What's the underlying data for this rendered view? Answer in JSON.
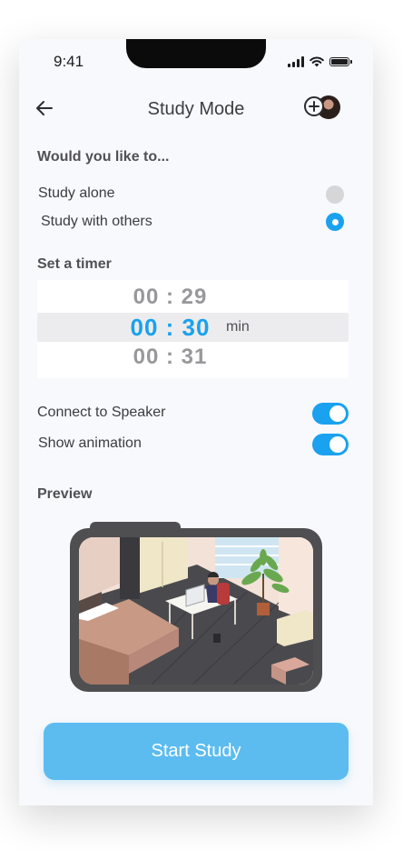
{
  "status_bar": {
    "time": "9:41"
  },
  "header": {
    "title": "Study Mode"
  },
  "study_choice": {
    "heading": "Would you like to...",
    "options": [
      {
        "label": "Study alone",
        "selected": false
      },
      {
        "label": "Study with others",
        "selected": true
      }
    ]
  },
  "timer": {
    "heading": "Set a timer",
    "values": [
      "00 : 29",
      "00 : 30",
      "00 : 31"
    ],
    "selected_index": 1,
    "unit": "min"
  },
  "settings": {
    "items": [
      {
        "label": "Connect to Speaker",
        "enabled": true
      },
      {
        "label": "Show animation",
        "enabled": true
      }
    ]
  },
  "preview": {
    "heading": "Preview"
  },
  "start_button": {
    "label": "Start Study"
  },
  "colors": {
    "accent": "#1aa1ef",
    "button": "#5cbcf0",
    "background": "#f8f9fc"
  }
}
